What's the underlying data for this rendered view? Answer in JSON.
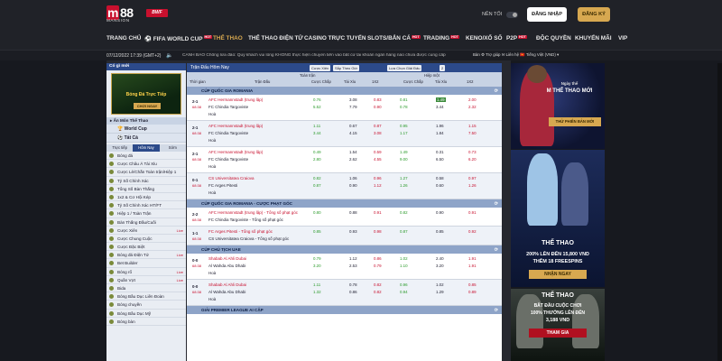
{
  "brand": {
    "mark": "88",
    "sub": "MANSION",
    "partner": "BWF"
  },
  "header": {
    "night_mode": "NỀN TỐI",
    "login": "ĐĂNG NHẬP",
    "register": "ĐĂNG KÝ"
  },
  "nav": [
    {
      "label": "TRANG CHỦ",
      "hot": ""
    },
    {
      "label": "FIFA WORLD CUP",
      "hot": "HOT"
    },
    {
      "label": "THỂ THAO",
      "hot": ""
    },
    {
      "label": "THỂ THAO ĐIỆN TỬ",
      "hot": ""
    },
    {
      "label": "CASINO TRỰC TUYẾN",
      "hot": ""
    },
    {
      "label": "SLOTS/BẮN CÁ",
      "hot": "HOT"
    },
    {
      "label": "TRADING",
      "hot": "HOT"
    },
    {
      "label": "KENO/XỔ SỐ",
      "hot": ""
    },
    {
      "label": "P2P",
      "hot": "HOT"
    },
    {
      "label": "ĐỘC QUYỀN",
      "hot": ""
    },
    {
      "label": "KHUYẾN MÃI",
      "hot": ""
    },
    {
      "label": "VIP",
      "hot": ""
    }
  ],
  "notice": {
    "time": "07/12/2022 17:39 (GMT+2)",
    "message": "CẢNH BÁO Chống lừa đảo: Quý khách vui lòng KHÔNG thực hiện chuyển tiền vào bất cứ tài khoản ngân hàng nào chưa được cung cấp",
    "tools": "Bàn ⚙ Trợ giúp ✉ Liên hệ 🇻🇳 Tiếng Việt (VND) ▾"
  },
  "sidebar": {
    "header": "Có gì mới",
    "banner_title": "Bóng Đá Trực Tiếp",
    "banner_button": "CHƠI NGAY",
    "section": "Ẩn Môn Thể Thao",
    "world_cup": "World Cup",
    "all": "Tất Cả",
    "tabs": [
      "Trực tiếp",
      "Hôm Nay",
      "Sớm"
    ],
    "items": [
      {
        "label": "Bóng đá",
        "count": ""
      },
      {
        "label": "Cược Châu Á Tài Xỉu",
        "count": ""
      },
      {
        "label": "Cược Lẻ/Chẵn Toàn trận/Hiệp 1",
        "count": ""
      },
      {
        "label": "Tỷ Số Chính Xác",
        "count": ""
      },
      {
        "label": "Tổng Số Bàn Thắng",
        "count": ""
      },
      {
        "label": "1x2 & Cơ Hội Kép",
        "count": ""
      },
      {
        "label": "Tỷ Số Chính Xác HT/FT",
        "count": ""
      },
      {
        "label": "Hiệp 1 / Toàn Trận",
        "count": ""
      },
      {
        "label": "Bàn Thắng Đầu/Cuối",
        "count": ""
      },
      {
        "label": "Cược Xiên",
        "count": "Live"
      },
      {
        "label": "Cược Chung Cuộc",
        "count": ""
      },
      {
        "label": "Cược Đặc Biệt",
        "count": ""
      },
      {
        "label": "Bóng đá Điện Tử",
        "count": "Live"
      },
      {
        "label": "Bet Builder",
        "count": ""
      },
      {
        "label": "Bóng rổ",
        "count": "Live"
      },
      {
        "label": "Quần Vợt",
        "count": "Live"
      },
      {
        "label": "Bida",
        "count": ""
      },
      {
        "label": "Bóng Bầu Dục Liên Đoàn",
        "count": ""
      },
      {
        "label": "Bóng chuyền",
        "count": ""
      },
      {
        "label": "Bóng Bầu Dục Mỹ",
        "count": ""
      },
      {
        "label": "Bóng bàn",
        "count": ""
      }
    ]
  },
  "main": {
    "title": "Trận Đấu Hôm Nay",
    "controls": [
      "Cược Xiên",
      "Sắp Theo Giờ",
      "Lựa Chọn Giải Đấu",
      "2"
    ],
    "col_full": "Toàn trận",
    "col_half": "Hiệp một",
    "cols": [
      "Thời gian",
      "Trận Đấu",
      "Cược Chấp",
      "Tài Xỉu",
      "1X2",
      "Cược Chấp",
      "Tài Xỉu",
      "1X2"
    ],
    "leagues": [
      {
        "name": "CÚP QUỐC GIA ROMANIA",
        "matches": [
          {
            "score": "2-1",
            "time": "68:38",
            "home": "AFC Hermannstadt (trung lập)",
            "away": "FC Chindia Targoviste",
            "draw": "Hoà",
            "odds": [
              "0.76",
              "3.08",
              "0.83",
              "0.81",
              "1.49",
              "2.00",
              "5.52",
              "7.79",
              "0.90",
              "0.78",
              "3.44",
              "2.32"
            ]
          },
          {
            "score": "2-1",
            "time": "68:38",
            "home": "AFC Hermannstadt (trung lập)",
            "away": "FC Chindia Targoviste",
            "draw": "Hoà",
            "odds": [
              "1.11",
              "0.67",
              "0.87",
              "0.95",
              "1.96",
              "1.15",
              "3.44",
              "4.15",
              "3.08",
              "1.17",
              "1.84",
              "7.50"
            ]
          },
          {
            "score": "2-1",
            "time": "68:38",
            "home": "AFC Hermannstadt (trung lập)",
            "away": "FC Chindia Targoviste",
            "draw": "Hoà",
            "odds": [
              "0.49",
              "1.54",
              "0.59",
              "1.49",
              "0.31",
              "0.73",
              "2.80",
              "2.62",
              "4.55",
              "9.00",
              "6.50",
              "6.20"
            ]
          },
          {
            "score": "0-1",
            "time": "68:38",
            "home": "CS Universitatea Craiova",
            "away": "FC Arges Pitesti",
            "draw": "Hoà",
            "odds": [
              "0.82",
              "1.06",
              "0.96",
              "1.27",
              "0.58",
              "0.97",
              "0.87",
              "0.90",
              "1.12",
              "1.26",
              "0.60",
              "1.26"
            ]
          }
        ]
      },
      {
        "name": "CÚP QUỐC GIA ROMANIA - CƯỢC PHẠT GÓC",
        "matches": [
          {
            "score": "2-2",
            "time": "68:38",
            "home": "AFC Hermannstadt (trung lập) - Tổng số phạt góc",
            "away": "FC Chindia Targoviste - Tổng số phạt góc",
            "draw": "",
            "odds": [
              "0.80",
              "0.88",
              "0.91",
              "0.82",
              "0.90",
              "0.91"
            ]
          },
          {
            "score": "1-1",
            "time": "68:38",
            "home": "FC Arges Pitesti - Tổng số phạt góc",
            "away": "CS Universitatea Craiova - Tổng số phạt góc",
            "draw": "",
            "odds": [
              "0.85",
              "0.93",
              "0.98",
              "0.87",
              "0.85",
              "0.92"
            ]
          }
        ]
      },
      {
        "name": "CÚP CHỦ TỊCH UAE",
        "matches": [
          {
            "score": "0-0",
            "time": "68:38",
            "home": "Shabab Al Ahli Dubai",
            "away": "Al Wahda Abu Dhabi",
            "draw": "Hoà",
            "odds": [
              "0.79",
              "1.12",
              "0.86",
              "1.02",
              "2.40",
              "1.91",
              "3.20",
              "2.53",
              "0.79",
              "1.10",
              "3.20",
              "1.91"
            ]
          },
          {
            "score": "0-0",
            "time": "68:38",
            "home": "Shabab Al Ahli Dubai",
            "away": "Al Wahda Abu Dhabi",
            "draw": "Hoà",
            "odds": [
              "1.11",
              "0.78",
              "0.82",
              "0.96",
              "1.02",
              "0.85",
              "1.32",
              "0.86",
              "0.82",
              "0.94",
              "1.29",
              "0.89"
            ]
          }
        ]
      },
      {
        "name": "GIẢI PREMIER LEAGUE AI CẬP",
        "matches": []
      }
    ]
  },
  "promos": [
    {
      "kicker": "Ngày thể",
      "title": "M THỂ THAO MỚI",
      "button": "THỬ PHIÊN BẢN MỚI"
    },
    {
      "title": "THỂ THAO",
      "line1": "200% LÊN ĐẾN 15,800 VND",
      "line2": "THÊM 18 FREESPINS",
      "button": "NHẬN NGAY"
    },
    {
      "title": "THỂ THAO",
      "line1": "BẮT ĐẦU CUỘC CHƠI",
      "line2": "100% THƯỞNG LÊN ĐẾN",
      "line3": "3,188 VND",
      "button": "THAM GIA"
    }
  ],
  "colors": {
    "accent": "#d7a850",
    "brand_red": "#c8102e",
    "table_blue": "#2c4a8a",
    "live_green": "#3a8a3a"
  }
}
